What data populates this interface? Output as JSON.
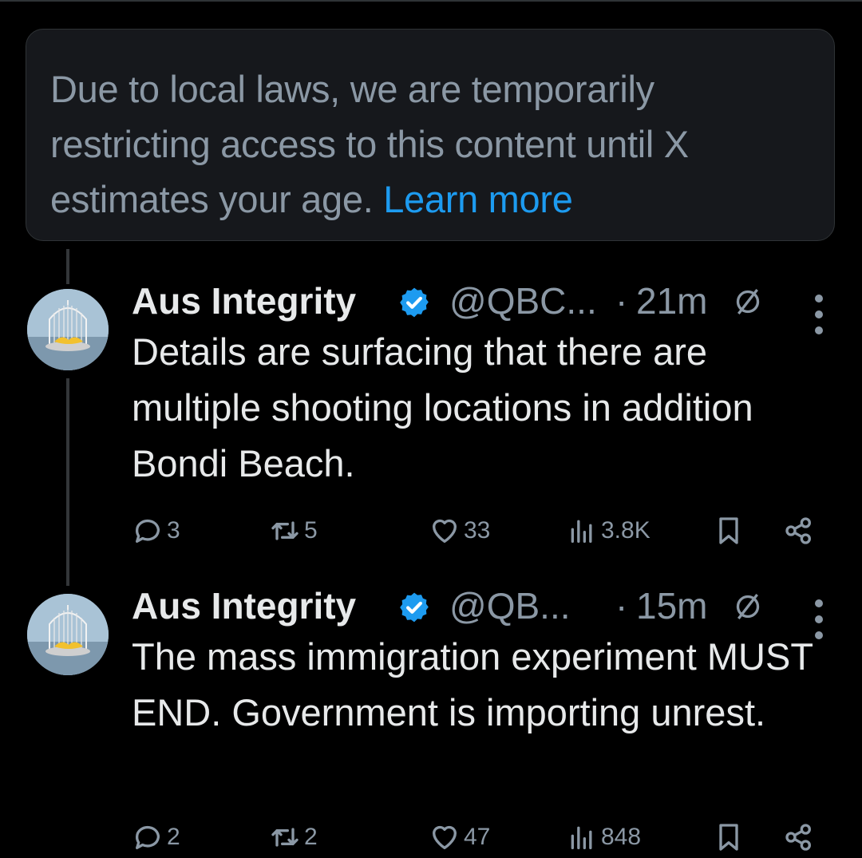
{
  "notice": {
    "text": "Due to local laws, we are temporarily restricting access to this content until X estimates your age.",
    "link_label": "Learn more"
  },
  "colors": {
    "background": "#000000",
    "card": "#16181c",
    "muted_text": "#8b98a5",
    "link": "#1d9bf0",
    "verified_badge": "#1d9bf0"
  },
  "tweets": [
    {
      "author_name": "Aus Integrity",
      "verified": true,
      "handle": "@QBC...",
      "separator": "·",
      "time": "21m",
      "text": "Details are surfacing that there are multiple shooting locations in addition Bondi Beach.",
      "replies": "3",
      "reposts": "5",
      "likes": "33",
      "views": "3.8K",
      "icons": [
        "reply-icon",
        "repost-icon",
        "like-icon",
        "views-icon",
        "bookmark-icon",
        "share-icon"
      ]
    },
    {
      "author_name": "Aus Integrity",
      "verified": true,
      "handle": "@QB...",
      "separator": "·",
      "time": "15m",
      "text": "The mass immigration experiment MUST END. Government is importing unrest.",
      "replies": "2",
      "reposts": "2",
      "likes": "47",
      "views": "848",
      "icons": [
        "reply-icon",
        "repost-icon",
        "like-icon",
        "views-icon",
        "bookmark-icon",
        "share-icon"
      ]
    }
  ]
}
